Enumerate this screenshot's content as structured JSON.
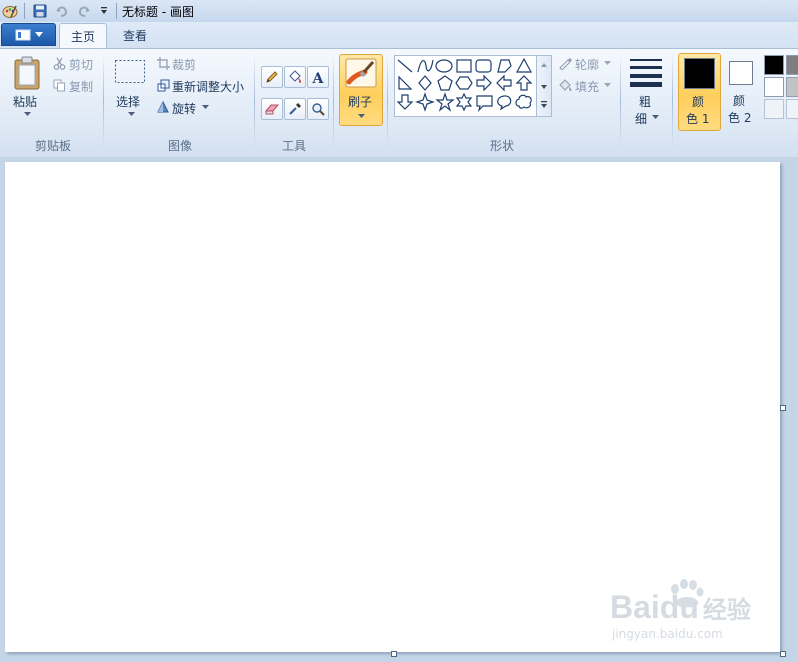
{
  "window": {
    "title": "无标题 - 画图"
  },
  "tabs": {
    "home": "主页",
    "view": "查看"
  },
  "clipboard": {
    "group": "剪贴板",
    "paste": "粘贴",
    "cut": "剪切",
    "copy": "复制"
  },
  "image": {
    "group": "图像",
    "select": "选择",
    "crop": "裁剪",
    "resize": "重新调整大小",
    "rotate": "旋转"
  },
  "tools": {
    "group": "工具"
  },
  "brushes": {
    "label": "刷子"
  },
  "shapes": {
    "group": "形状",
    "outline": "轮廓",
    "fill": "填充"
  },
  "size": {
    "label_1": "粗",
    "label_2": "细"
  },
  "colors": {
    "color1_a": "颜",
    "color1_b": "色 1",
    "color2_a": "颜",
    "color2_b": "色 2",
    "color1": "#000000",
    "color2": "#ffffff"
  },
  "watermark": {
    "brand": "Bai",
    "brand2": "du",
    "jingyan": "经验",
    "url": "jingyan.baidu.com"
  }
}
